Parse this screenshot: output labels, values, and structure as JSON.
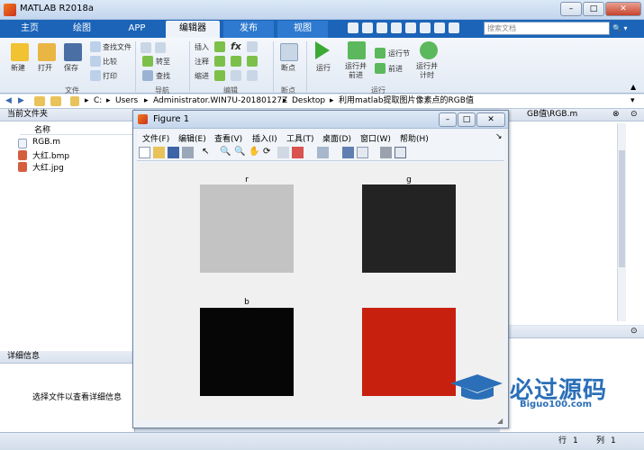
{
  "window": {
    "title": "MATLAB R2018a",
    "min": "–",
    "max": "□",
    "close": "✕"
  },
  "tabs": [
    {
      "label": "主页"
    },
    {
      "label": "绘图"
    },
    {
      "label": "APP"
    },
    {
      "label": "编辑器"
    },
    {
      "label": "发布"
    },
    {
      "label": "视图"
    }
  ],
  "search": {
    "placeholder": "搜索文档"
  },
  "ribbon": {
    "file": {
      "new": "新建",
      "open": "打开",
      "save": "保存",
      "find_files": "查找文件",
      "compare": "比较",
      "print": "打印",
      "section": "文件"
    },
    "nav": {
      "goto": "转至",
      "find": "查找",
      "section": "导航"
    },
    "edit": {
      "insert": "插入",
      "comment": "注释",
      "indent": "缩进",
      "fx": "fx",
      "section": "编辑"
    },
    "breakpoints": {
      "label": "断点",
      "section": "断点"
    },
    "run": {
      "run": "运行",
      "run_advance": "运行并\n前进",
      "run_section": "运行节",
      "advance": "前进",
      "run_time": "运行并\n计时",
      "section": "运行"
    }
  },
  "address": {
    "drive": "C:",
    "parts": [
      "Users",
      "Administrator.WIN7U-20180127Z",
      "Desktop",
      "利用matlab提取图片像素点的RGB值"
    ]
  },
  "current_folder": {
    "title": "当前文件夹",
    "col_name": "名称",
    "files": [
      {
        "name": "RGB.m"
      },
      {
        "name": "大红.bmp"
      },
      {
        "name": "大红.jpg"
      }
    ]
  },
  "details": {
    "title": "详细信息",
    "empty": "选择文件以查看详细信息"
  },
  "editor_tab": {
    "title": "GB值\\RGB.m"
  },
  "figure": {
    "title": "Figure 1",
    "menu": [
      "文件(F)",
      "编辑(E)",
      "查看(V)",
      "插入(I)",
      "工具(T)",
      "桌面(D)",
      "窗口(W)",
      "帮助(H)"
    ],
    "panels": [
      {
        "label": "r",
        "color": "#c3c3c3"
      },
      {
        "label": "g",
        "color": "#232323"
      },
      {
        "label": "b",
        "color": "#060606"
      },
      {
        "label": "",
        "color": "#c8200f"
      }
    ]
  },
  "status": {
    "row_label": "行",
    "row": "1",
    "col_label": "列",
    "col": "1"
  },
  "watermark": {
    "main": "必过源码",
    "sub": "Biguo100.com"
  }
}
